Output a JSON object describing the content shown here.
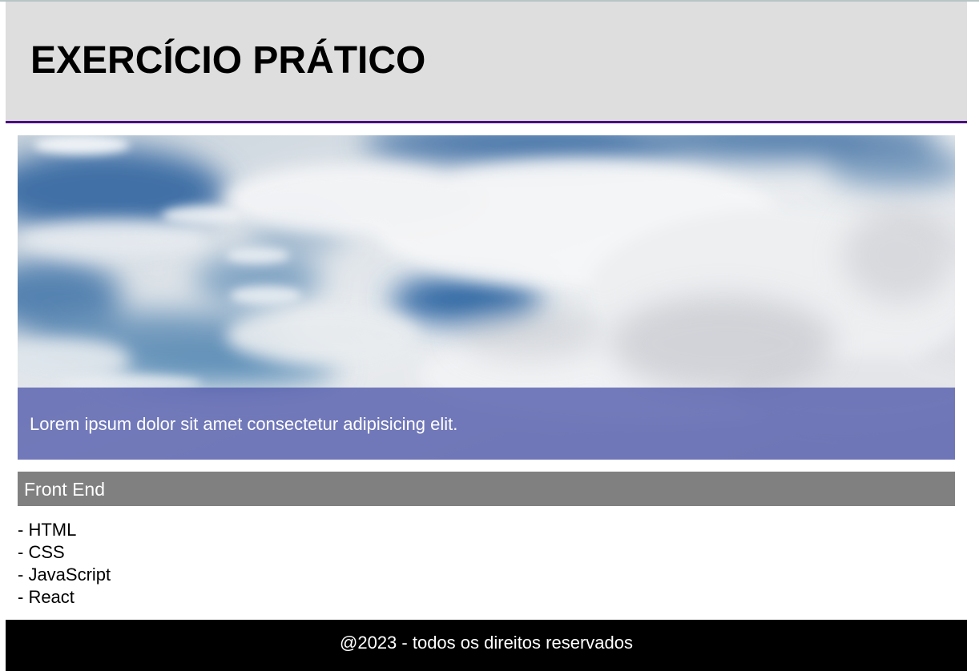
{
  "header": {
    "title": "EXERCÍCIO PRÁTICO"
  },
  "hero": {
    "image": "cloudy-sky-image",
    "caption": "Lorem ipsum dolor sit amet consectetur adipisicing elit."
  },
  "section": {
    "title": "Front End",
    "items": [
      "- HTML",
      "- CSS",
      "- JavaScript",
      "- React"
    ]
  },
  "footer": {
    "text": "@2023 - todos os direitos reservados"
  },
  "colors": {
    "header_bg": "#dedede",
    "header_border": "#4b1080",
    "caption_bg": "#5058aa",
    "section_bg": "#808080",
    "footer_bg": "#000000"
  }
}
